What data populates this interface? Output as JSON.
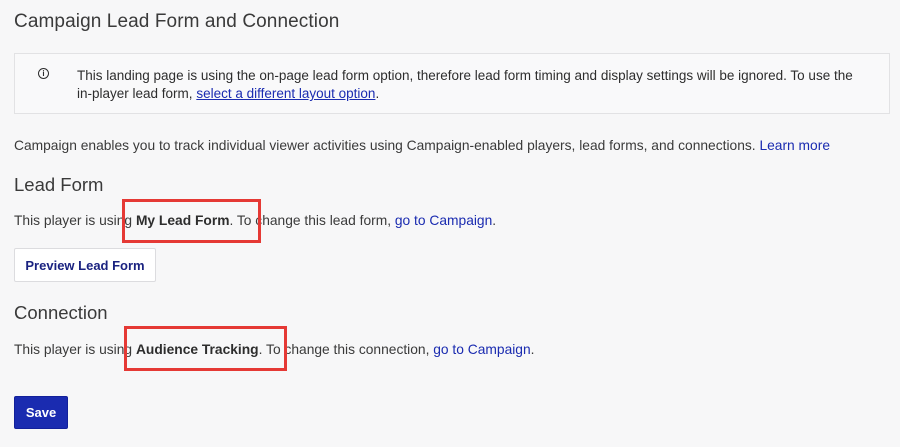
{
  "page": {
    "title": "Campaign Lead Form and Connection"
  },
  "notice": {
    "icon": "info-icon",
    "icon_glyph": "i",
    "text": "This landing page is using the on-page lead form option, therefore lead form timing and display settings will be ignored. To use the in-player lead form, ",
    "link_label": "select a different layout option",
    "text_end": "."
  },
  "intro": {
    "text": "Campaign enables you to track individual viewer activities using Campaign-enabled players, lead forms, and connections. ",
    "link_label": "Learn more"
  },
  "lead_form": {
    "heading": "Lead Form",
    "text_before": "This player is using ",
    "value": "My Lead Form",
    "text_after": ". To change this lead form, ",
    "link_label": "go to Campaign",
    "text_end": ".",
    "preview_button_label": "Preview Lead Form"
  },
  "connection": {
    "heading": "Connection",
    "text_before": "This player is using ",
    "value": "Audience Tracking",
    "text_after": ". To change this connection, ",
    "link_label": "go to Campaign",
    "text_end": "."
  },
  "actions": {
    "save_label": "Save"
  },
  "colors": {
    "link": "#1a2bb0",
    "primary_button": "#1a2bb0",
    "annotation_highlight": "#e53935",
    "background": "#f7f7f8"
  }
}
